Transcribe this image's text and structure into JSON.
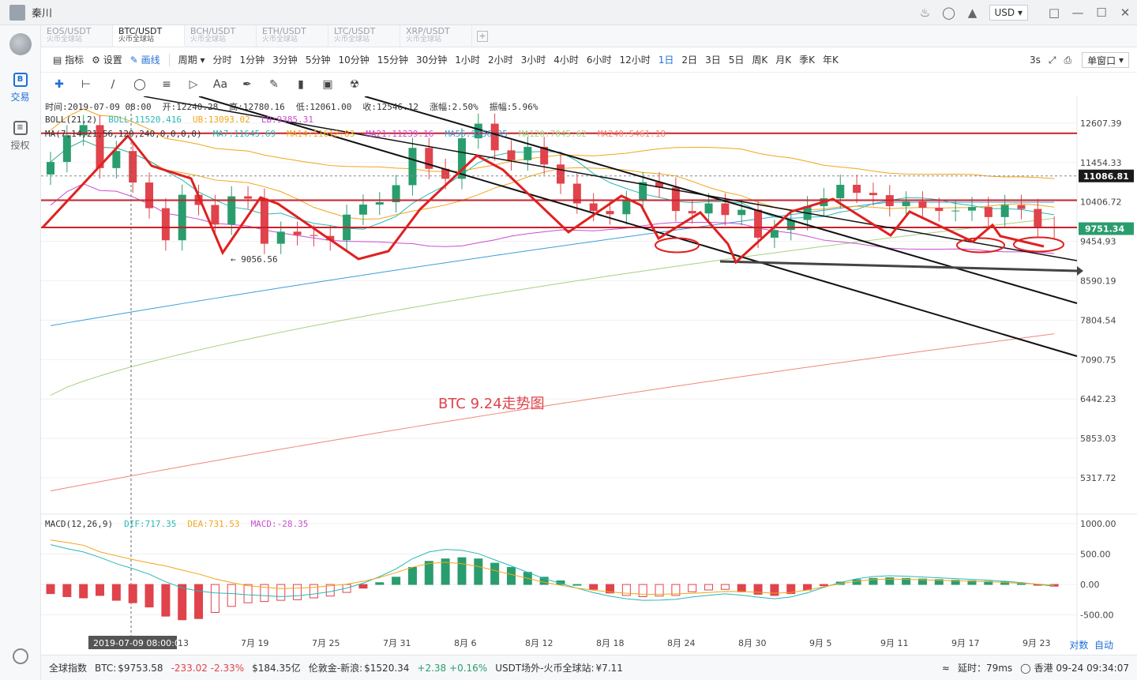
{
  "app": {
    "username": "秦川",
    "currency": "USD"
  },
  "tabs": [
    {
      "pair": "EOS/USDT",
      "source": "火币全球站",
      "active": false
    },
    {
      "pair": "BTC/USDT",
      "source": "火币全球站",
      "active": true
    },
    {
      "pair": "BCH/USDT",
      "source": "火币全球站",
      "active": false
    },
    {
      "pair": "ETH/USDT",
      "source": "火币全球站",
      "active": false
    },
    {
      "pair": "LTC/USDT",
      "source": "火币全球站",
      "active": false
    },
    {
      "pair": "XRP/USDT",
      "source": "火币全球站",
      "active": false
    }
  ],
  "sidebar": {
    "trade": "交易",
    "auth": "授权"
  },
  "toolbar": {
    "indicator": "指标",
    "settings": "设置",
    "draw": "画线",
    "period": "周期",
    "periods": [
      "分时",
      "1分钟",
      "3分钟",
      "5分钟",
      "10分钟",
      "15分钟",
      "30分钟",
      "1小时",
      "2小时",
      "3小时",
      "4小时",
      "6小时",
      "12小时",
      "1日",
      "2日",
      "3日",
      "5日",
      "周K",
      "月K",
      "季K",
      "年K"
    ],
    "active_period": "1日",
    "refresh": "3s",
    "window_mode": "单窗口"
  },
  "legend": {
    "ohlc": {
      "time": "时间:2019-07-09 08:00",
      "open": "开:12240.28",
      "high": "高:12780.16",
      "low": "低:12061.00",
      "close": "收:12546.12",
      "change": "涨幅:2.50%",
      "amplitude": "振幅:5.96%"
    },
    "boll": {
      "name": "BOLL(21,2)",
      "mid": "BOLL:11520.416",
      "ub": "UB:13093.02",
      "lb": "LB:9385.31"
    },
    "ma": {
      "name": "MA(7,14,21,56,120,240,0,0,0,0)",
      "ma7": "MA7:11645.69",
      "ma14": "MA14:11612.83",
      "ma21": "MA21:11239.16",
      "ma56": "MA56:9336.35",
      "ma120": "MA120:7045.62",
      "ma240": "MA240:5461.18"
    },
    "macd": {
      "name": "MACD(12,26,9)",
      "dif": "DIF:717.35",
      "dea": "DEA:731.53",
      "macd": "MACD:-28.35"
    }
  },
  "chart_data": {
    "type": "candlestick",
    "annotation": "BTC 9.24走势图",
    "price_ticks": [
      "12607.39",
      "11454.33",
      "10406.72",
      "9454.93",
      "8590.19",
      "7804.54",
      "7090.75",
      "6442.23",
      "5853.03",
      "5317.72"
    ],
    "price_marks": {
      "dashed": "11086.81",
      "current": "9751.34",
      "low_label": "9056.56"
    },
    "macd_ticks": [
      "1000.00",
      "500.00",
      "0.00",
      "-500.00"
    ],
    "x_ticks": [
      "2019-07-09 08:00:00",
      "13",
      "7月 19",
      "7月 25",
      "7月 31",
      "8月 6",
      "8月 12",
      "8月 18",
      "8月 24",
      "8月 30",
      "9月 5",
      "9月 11",
      "9月 17",
      "9月 23"
    ],
    "colors": {
      "up": "#2a9d6e",
      "down": "#e0434b",
      "ma7": "#29b8b5",
      "ma14": "#f2a51a",
      "ma21": "#c84fd0",
      "ma56": "#3aa0d8",
      "ma120": "#a8d080",
      "ma240": "#f08878"
    },
    "closes": [
      11470,
      12240,
      12546,
      11300,
      11780,
      10910,
      10250,
      9480,
      10590,
      10330,
      9850,
      10550,
      10490,
      9400,
      9680,
      9600,
      9580,
      9480,
      10090,
      10340,
      10400,
      10840,
      11870,
      11280,
      11010,
      12150,
      12590,
      11800,
      11520,
      11900,
      11400,
      10880,
      10370,
      10180,
      10100,
      10430,
      10920,
      10780,
      10180,
      10120,
      10370,
      10080,
      10210,
      9540,
      9720,
      9960,
      10300,
      10500,
      10850,
      10640,
      10580,
      10300,
      10420,
      10260,
      10180,
      10190,
      10280,
      10030,
      10330,
      10230,
      9800,
      9760
    ],
    "macd_hist": [
      -150,
      -200,
      -220,
      -180,
      -260,
      -300,
      -370,
      -520,
      -580,
      -560,
      -460,
      -360,
      -300,
      -280,
      -260,
      -250,
      -220,
      -190,
      -130,
      -60,
      30,
      120,
      280,
      380,
      420,
      440,
      420,
      350,
      280,
      200,
      120,
      60,
      0,
      -80,
      -140,
      -180,
      -200,
      -190,
      -180,
      -120,
      -90,
      -80,
      -120,
      -160,
      -180,
      -150,
      -90,
      -20,
      40,
      80,
      100,
      110,
      100,
      90,
      80,
      70,
      60,
      50,
      40,
      20,
      -10,
      -28
    ],
    "gain_label_colors": [
      "#e0434b"
    ]
  },
  "status": {
    "index": "全球指数",
    "btc_label": "BTC:",
    "btc_price": "$9753.58",
    "btc_change": "-233.02 -2.33%",
    "btc_cap": "$184.35亿",
    "gold_label": "伦敦金-新浪:",
    "gold_price": "$1520.34",
    "gold_change": "+2.38 +0.16%",
    "usdt_label": "USDT场外-火币全球站:",
    "usdt_price": "¥7.11",
    "latency": "延时：79ms",
    "region": "香港 09-24 09:34:07"
  },
  "axis_buttons": {
    "log": "对数",
    "auto": "自动"
  }
}
